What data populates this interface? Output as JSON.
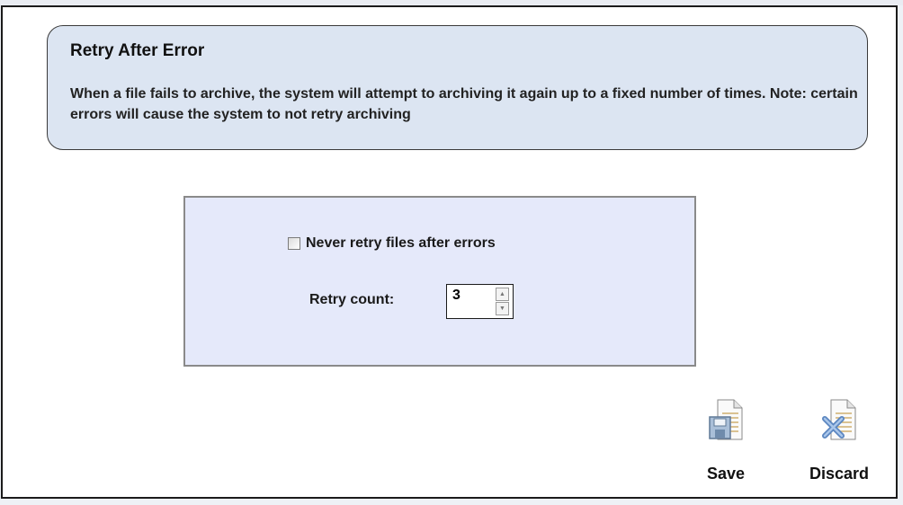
{
  "info": {
    "title": "Retry After Error",
    "description": "When a file fails to archive, the system will attempt to archiving it again up to a fixed number of times. Note: certain errors will cause the system to not retry archiving"
  },
  "settings": {
    "never_retry_label": "Never retry files after errors",
    "never_retry_checked": false,
    "retry_count_label": "Retry count:",
    "retry_count_value": "3"
  },
  "actions": {
    "save_label": "Save",
    "discard_label": "Discard"
  },
  "icons": {
    "save": "save-document-icon",
    "discard": "discard-document-icon",
    "spin_up": "chevron-up-icon",
    "spin_down": "chevron-down-icon"
  },
  "colors": {
    "info_bg": "#dce5f2",
    "panel_bg": "#e5e9fa",
    "frame_border": "#1b1b1b"
  }
}
